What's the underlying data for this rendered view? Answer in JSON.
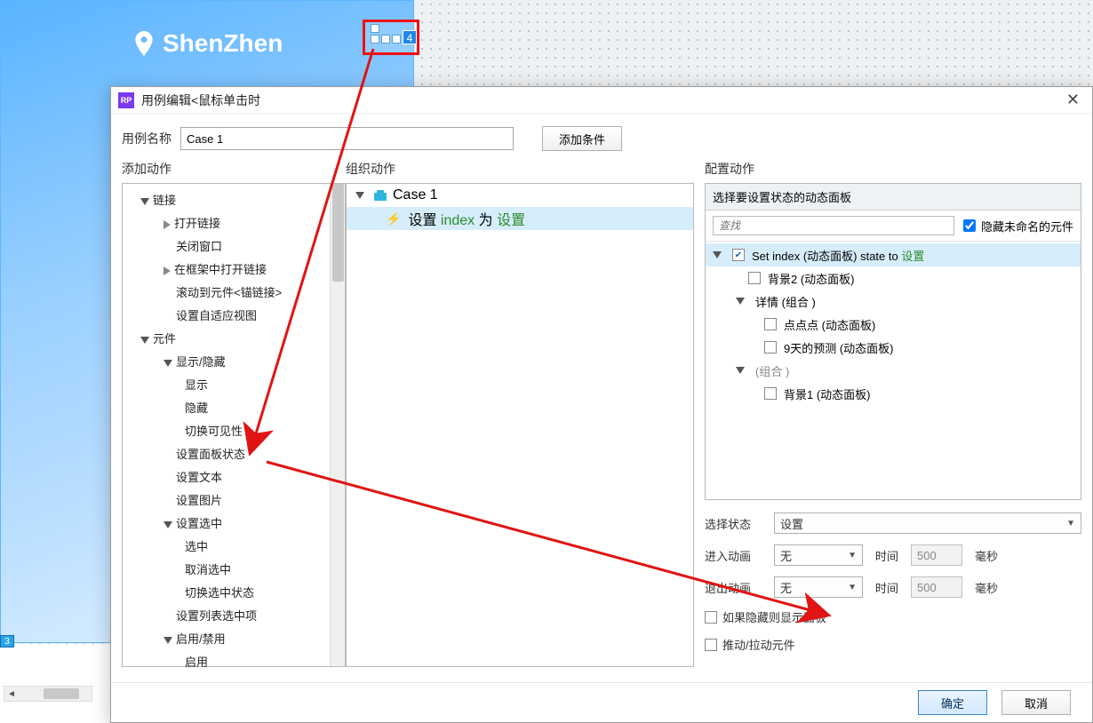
{
  "canvas": {
    "location_label": "ShenZhen",
    "widget_badge": "4",
    "corner_tag": "3"
  },
  "dialog": {
    "app_badge": "RP",
    "title": "用例编辑<鼠标单击 时>",
    "title_visible": "用例编辑<鼠标单击时",
    "case_name_label": "用例名称",
    "case_name_value": "Case 1",
    "add_condition_btn": "添加条件",
    "columns": {
      "left_header": "添加动作",
      "mid_header": "组织动作",
      "right_header": "配置动作"
    },
    "actions_tree": {
      "groups": [
        {
          "label": "链接",
          "expanded": true,
          "children": [
            {
              "label": "打开链接",
              "hasChildren": true
            },
            {
              "label": "关闭窗口"
            },
            {
              "label": "在框架中打开链接",
              "hasChildren": true
            },
            {
              "label": "滚动到元件<锚链接>"
            },
            {
              "label": "设置自适应视图"
            }
          ]
        },
        {
          "label": "元件",
          "expanded": true,
          "children": [
            {
              "label": "显示/隐藏",
              "expanded": true,
              "children": [
                {
                  "label": "显示"
                },
                {
                  "label": "隐藏"
                },
                {
                  "label": "切换可见性"
                }
              ]
            },
            {
              "label": "设置面板状态"
            },
            {
              "label": "设置文本"
            },
            {
              "label": "设置图片"
            },
            {
              "label": "设置选中",
              "expanded": true,
              "children": [
                {
                  "label": "选中"
                },
                {
                  "label": "取消选中"
                },
                {
                  "label": "切换选中状态"
                }
              ]
            },
            {
              "label": "设置列表选中项"
            },
            {
              "label": "启用/禁用",
              "expanded": true,
              "children": [
                {
                  "label": "启用"
                }
              ]
            }
          ]
        }
      ]
    },
    "mid_tree": {
      "case_label": "Case 1",
      "action_prefix": "设置",
      "action_target": "index",
      "action_middle": "为",
      "action_value": "设置"
    },
    "right": {
      "panel_title": "选择要设置状态的动态面板",
      "search_placeholder": "查找",
      "hide_unnamed_label": "隐藏未命名的元件",
      "hide_unnamed_checked": true,
      "tree": [
        {
          "indent": 0,
          "expanded": true,
          "checked": true,
          "selected": true,
          "prefix": "Set index (动态面板) state to ",
          "suffix_green": "设置"
        },
        {
          "indent": 1,
          "checked": false,
          "label": "背景2 (动态面板)"
        },
        {
          "indent": 1,
          "expanded": true,
          "group": true,
          "label": "详情 (组合 )"
        },
        {
          "indent": 2,
          "checked": false,
          "label": "点点点 (动态面板)"
        },
        {
          "indent": 2,
          "checked": false,
          "label": "9天的预测 (动态面板)"
        },
        {
          "indent": 1,
          "expanded": true,
          "group": true,
          "grey": true,
          "label": "(组合 )"
        },
        {
          "indent": 2,
          "checked": false,
          "label": "背景1 (动态面板)"
        }
      ],
      "config": {
        "state_label": "选择状态",
        "state_value": "设置",
        "enter_anim_label": "进入动画",
        "enter_anim_value": "无",
        "exit_anim_label": "退出动画",
        "exit_anim_value": "无",
        "time_label": "时间",
        "time_value": "500",
        "ms_label": "毫秒",
        "chk_show_if_hidden": "如果隐藏则显示面板",
        "chk_push_pull": "推动/拉动元件"
      }
    },
    "buttons": {
      "ok": "确定",
      "cancel": "取消"
    }
  },
  "arrows": {
    "color": "#e11414"
  }
}
